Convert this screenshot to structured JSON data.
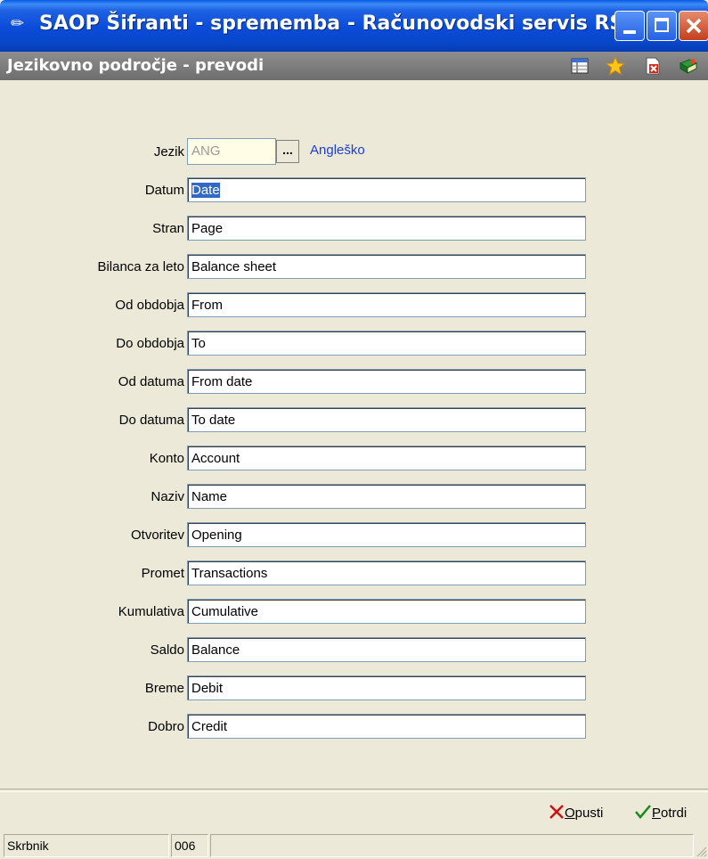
{
  "window": {
    "title": "SAOP Šifranti - sprememba - Računovodski servis RS",
    "subtitle": "Jezikovno področje - prevodi"
  },
  "form": {
    "jezik": {
      "label": "Jezik",
      "code": "ANG",
      "name": "Angleško",
      "button": "..."
    },
    "fields": [
      {
        "label": "Datum",
        "value": "Date"
      },
      {
        "label": "Stran",
        "value": "Page"
      },
      {
        "label": "Bilanca za leto",
        "value": "Balance sheet"
      },
      {
        "label": "Od obdobja",
        "value": "From"
      },
      {
        "label": "Do obdobja",
        "value": "To"
      },
      {
        "label": "Od datuma",
        "value": "From date"
      },
      {
        "label": "Do datuma",
        "value": "To date"
      },
      {
        "label": "Konto",
        "value": "Account"
      },
      {
        "label": "Naziv",
        "value": "Name"
      },
      {
        "label": "Otvoritev",
        "value": "Opening"
      },
      {
        "label": "Promet",
        "value": "Transactions"
      },
      {
        "label": "Kumulativa",
        "value": "Cumulative"
      },
      {
        "label": "Saldo",
        "value": "Balance"
      },
      {
        "label": "Breme",
        "value": "Debit"
      },
      {
        "label": "Dobro",
        "value": "Credit"
      }
    ]
  },
  "actions": {
    "cancel_first": "O",
    "cancel_rest": "pusti",
    "confirm_first": "P",
    "confirm_rest": "otrdi"
  },
  "status": {
    "user": "Skrbnik",
    "code": "006"
  },
  "colors": {
    "title_bar": "#0a4bd8",
    "sub_bar": "#7e7e7e",
    "link_blue": "#1c3fd8",
    "selection": "#316ac5",
    "cancel_red": "#d01010",
    "confirm_green": "#1a8a1a"
  }
}
